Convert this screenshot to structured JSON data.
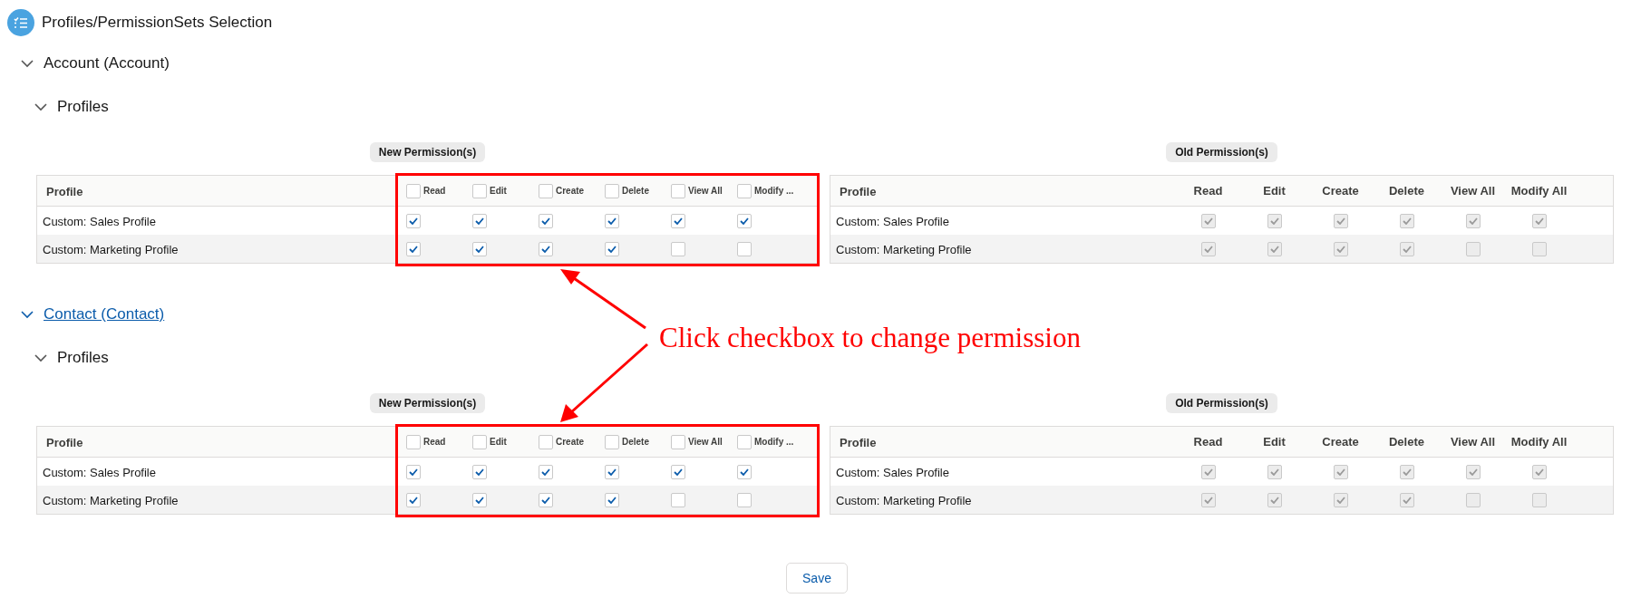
{
  "header": {
    "title": "Profiles/PermissionSets Selection"
  },
  "sections": [
    {
      "name": "Account (Account)",
      "link": false,
      "expanded": true,
      "subsection": {
        "name": "Profiles",
        "expanded": true
      },
      "new_permissions": {
        "label": "New Permission(s)",
        "highlighted": true,
        "disabled": false,
        "profile_heading": "Profile",
        "columns": [
          {
            "label": "Read",
            "checked": false
          },
          {
            "label": "Edit",
            "checked": false
          },
          {
            "label": "Create",
            "checked": false
          },
          {
            "label": "Delete",
            "checked": false
          },
          {
            "label": "View All",
            "checked": false
          },
          {
            "label": "Modify ...",
            "checked": false
          }
        ],
        "rows": [
          {
            "profile": "Custom: Sales Profile",
            "cells": [
              {
                "checked": true
              },
              {
                "checked": true
              },
              {
                "checked": true
              },
              {
                "checked": true
              },
              {
                "checked": true
              },
              {
                "checked": true
              }
            ]
          },
          {
            "profile": "Custom: Marketing Profile",
            "cells": [
              {
                "checked": true
              },
              {
                "checked": true
              },
              {
                "checked": true
              },
              {
                "checked": true
              },
              {
                "checked": false
              },
              {
                "checked": false
              }
            ]
          }
        ]
      },
      "old_permissions": {
        "label": "Old Permission(s)",
        "highlighted": false,
        "disabled": true,
        "profile_heading": "Profile",
        "columns": [
          {
            "label": "Read"
          },
          {
            "label": "Edit"
          },
          {
            "label": "Create"
          },
          {
            "label": "Delete"
          },
          {
            "label": "View All"
          },
          {
            "label": "Modify All"
          }
        ],
        "rows": [
          {
            "profile": "Custom: Sales Profile",
            "cells": [
              {
                "checked": true
              },
              {
                "checked": true
              },
              {
                "checked": true
              },
              {
                "checked": true
              },
              {
                "checked": true
              },
              {
                "checked": true
              }
            ]
          },
          {
            "profile": "Custom: Marketing Profile",
            "cells": [
              {
                "checked": true
              },
              {
                "checked": true
              },
              {
                "checked": true
              },
              {
                "checked": true
              },
              {
                "checked": false
              },
              {
                "checked": false
              }
            ]
          }
        ]
      }
    },
    {
      "name": "Contact (Contact)",
      "link": true,
      "expanded": true,
      "subsection": {
        "name": "Profiles",
        "expanded": true
      },
      "new_permissions": {
        "label": "New Permission(s)",
        "highlighted": true,
        "disabled": false,
        "profile_heading": "Profile",
        "columns": [
          {
            "label": "Read",
            "checked": false
          },
          {
            "label": "Edit",
            "checked": false
          },
          {
            "label": "Create",
            "checked": false
          },
          {
            "label": "Delete",
            "checked": false
          },
          {
            "label": "View All",
            "checked": false
          },
          {
            "label": "Modify ...",
            "checked": false
          }
        ],
        "rows": [
          {
            "profile": "Custom: Sales Profile",
            "cells": [
              {
                "checked": true
              },
              {
                "checked": true
              },
              {
                "checked": true
              },
              {
                "checked": true
              },
              {
                "checked": true
              },
              {
                "checked": true
              }
            ]
          },
          {
            "profile": "Custom: Marketing Profile",
            "cells": [
              {
                "checked": true
              },
              {
                "checked": true
              },
              {
                "checked": true
              },
              {
                "checked": true
              },
              {
                "checked": false
              },
              {
                "checked": false
              }
            ]
          }
        ]
      },
      "old_permissions": {
        "label": "Old Permission(s)",
        "highlighted": false,
        "disabled": true,
        "profile_heading": "Profile",
        "columns": [
          {
            "label": "Read"
          },
          {
            "label": "Edit"
          },
          {
            "label": "Create"
          },
          {
            "label": "Delete"
          },
          {
            "label": "View All"
          },
          {
            "label": "Modify All"
          }
        ],
        "rows": [
          {
            "profile": "Custom: Sales Profile",
            "cells": [
              {
                "checked": true
              },
              {
                "checked": true
              },
              {
                "checked": true
              },
              {
                "checked": true
              },
              {
                "checked": true
              },
              {
                "checked": true
              }
            ]
          },
          {
            "profile": "Custom: Marketing Profile",
            "cells": [
              {
                "checked": true
              },
              {
                "checked": true
              },
              {
                "checked": true
              },
              {
                "checked": true
              },
              {
                "checked": false
              },
              {
                "checked": false
              }
            ]
          }
        ]
      }
    }
  ],
  "annotation": {
    "text": "Click checkbox to change permission"
  },
  "save_button": {
    "label": "Save"
  }
}
